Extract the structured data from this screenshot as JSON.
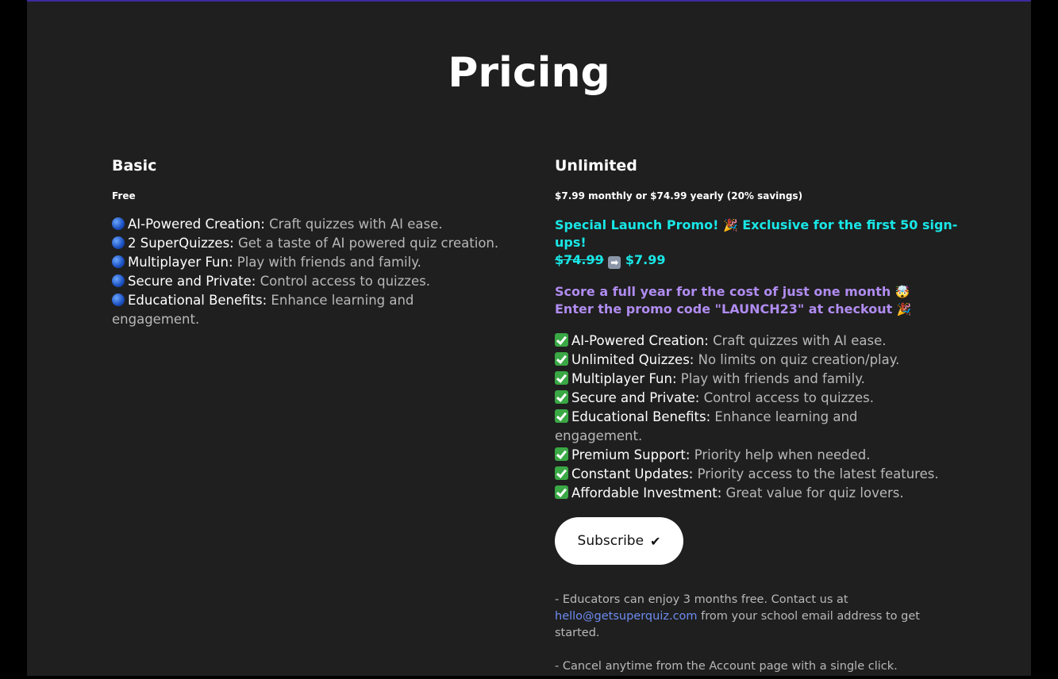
{
  "page": {
    "title": "Pricing"
  },
  "basic": {
    "name": "Basic",
    "price": "Free",
    "features": [
      {
        "name": "AI-Powered Creation:",
        "desc": " Craft quizzes with AI ease."
      },
      {
        "name": "2 SuperQuizzes:",
        "desc": " Get a taste of AI powered quiz creation."
      },
      {
        "name": "Multiplayer Fun:",
        "desc": " Play with friends and family."
      },
      {
        "name": "Secure and Private:",
        "desc": " Control access to quizzes."
      },
      {
        "name": "Educational Benefits:",
        "desc": " Enhance learning and engagement."
      }
    ],
    "bullet_icon": "blue-circle-icon"
  },
  "unlimited": {
    "name": "Unlimited",
    "price": "$7.99 monthly or $74.99 yearly (20% savings)",
    "promo_line1": "Special Launch Promo! ",
    "promo_line1b": " Exclusive for the first 50 sign-ups!",
    "promo_old_price": "$74.99",
    "promo_new_price": " $7.99",
    "promo_line2": "Score a full year for the cost of just one month ",
    "promo_line3": "Enter the promo code \"LAUNCH23\" at checkout ",
    "features": [
      {
        "name": "AI-Powered Creation:",
        "desc": " Craft quizzes with AI ease."
      },
      {
        "name": "Unlimited Quizzes:",
        "desc": " No limits on quiz creation/play."
      },
      {
        "name": "Multiplayer Fun:",
        "desc": " Play with friends and family."
      },
      {
        "name": "Secure and Private:",
        "desc": " Control access to quizzes."
      },
      {
        "name": "Educational Benefits:",
        "desc": " Enhance learning and engagement."
      },
      {
        "name": "Premium Support:",
        "desc": " Priority help when needed."
      },
      {
        "name": "Constant Updates:",
        "desc": " Priority access to the latest features."
      },
      {
        "name": "Affordable Investment:",
        "desc": " Great value for quiz lovers."
      }
    ],
    "bullet_icon": "check-mark-icon",
    "subscribe_label": "Subscribe",
    "note1_pre": "- Educators can enjoy 3 months free. Contact us at",
    "note1_email": "hello@getsuperquiz.com",
    "note1_post": " from your school email address to get started.",
    "note2": "- Cancel anytime from the Account page with a single click."
  },
  "colors": {
    "background": "#1f1f1f",
    "promo_cyan": "#19e6e6",
    "promo_purple": "#b08cf0",
    "link": "#6d8cf0",
    "check_green": "#3aa845"
  }
}
